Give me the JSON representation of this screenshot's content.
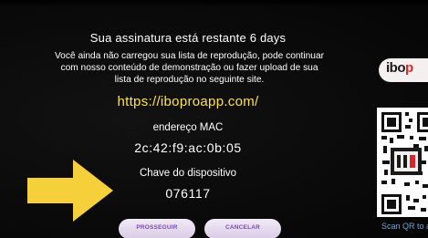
{
  "dialog": {
    "subscription_text": "Sua assinatura está restante  6 days",
    "message_lines": [
      "Você ainda não carregou sua lista de reprodução, pode continuar",
      "com nosso conteúdo de demonstração ou fazer upload de sua",
      "lista de reprodução no seguinte site."
    ],
    "site_url": "https://iboproapp.com/",
    "mac_label": "endereço MAC",
    "mac_value": "2c:42:f9:ac:0b:05",
    "device_key_label": "Chave do dispositivo",
    "device_key_value": "076117"
  },
  "buttons": {
    "proceed_label": "PROSSEGUIR",
    "cancel_label": "CANCELAR"
  },
  "side_panel": {
    "logo_text_dark": "ibo",
    "logo_text_red": "p",
    "qr_caption": "Scan QR to ac"
  },
  "colors": {
    "url_yellow": "#ffe14a",
    "arrow_yellow": "#f5d03a",
    "button_text_purple": "#7a4aa8",
    "logo_red": "#d8272b",
    "scan_blue": "#6fa8d8"
  },
  "icons": {
    "pointer": "arrow-right-icon",
    "qr": "qr-code-icon"
  }
}
